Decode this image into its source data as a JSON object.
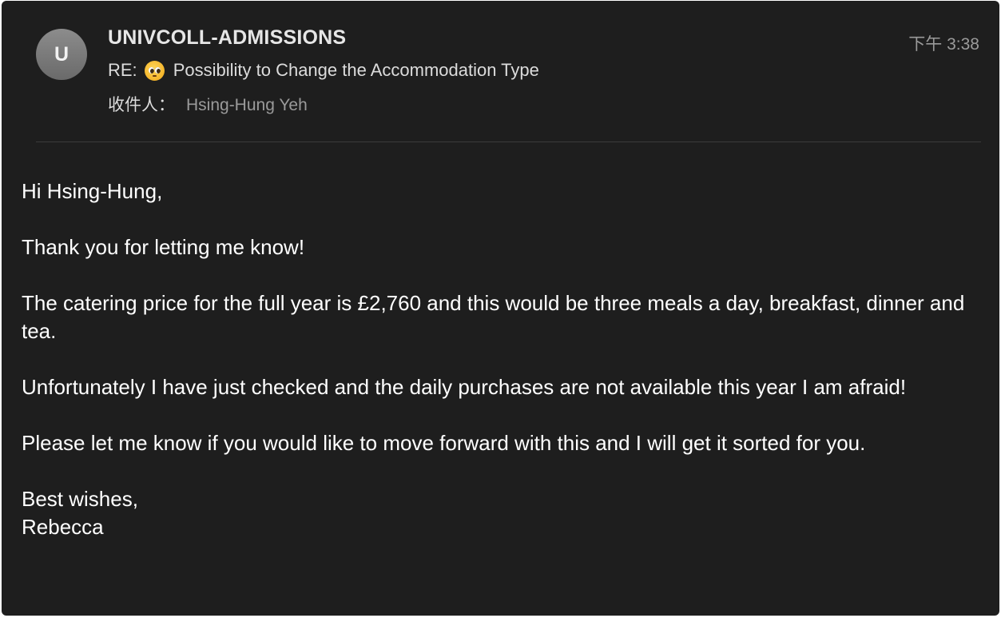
{
  "email": {
    "avatar_initial": "U",
    "sender": "UNIVCOLL-ADMISSIONS",
    "time": "下午 3:38",
    "subject_prefix": "RE:",
    "subject_emoji": "pleading-face-emoji",
    "subject": "Possibility to Change the Accommodation Type",
    "recipient_label": "收件人：",
    "recipient_name": "Hsing-Hung Yeh"
  },
  "body": {
    "greeting": "Hi Hsing-Hung,",
    "para1": "Thank you for letting me know!",
    "para2": "The catering price for the full year is £2,760 and this would be three meals a day, breakfast, dinner and tea.",
    "para3": "Unfortunately I have just checked and the daily purchases are not available this year I am afraid!",
    "para4": "Please let me know if you would like to move forward with this and I will get it sorted for you.",
    "signoff": "Best wishes,",
    "signature": "Rebecca"
  },
  "colors": {
    "background": "#1e1e1e",
    "text_primary": "#ffffff",
    "text_secondary": "#9a9a9a",
    "avatar": "#7a7a7a"
  }
}
